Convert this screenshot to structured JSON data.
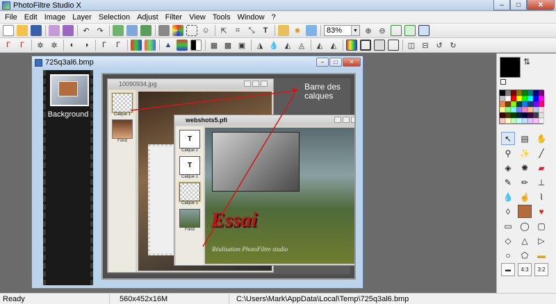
{
  "app": {
    "title": "PhotoFiltre Studio X"
  },
  "window_controls": {
    "minimize": "–",
    "maximize": "□",
    "close": "✕"
  },
  "menu": [
    "File",
    "Edit",
    "Image",
    "Layer",
    "Selection",
    "Adjust",
    "Filter",
    "View",
    "Tools",
    "Window",
    "?"
  ],
  "toolbar": {
    "zoom_value": "83%"
  },
  "document": {
    "title": "725q3al6.bmp",
    "film_label": "Background",
    "inner_window_1": {
      "title": "10090934.jpg",
      "layers": [
        "Calque 1",
        "Fond"
      ]
    },
    "inner_window_2": {
      "title": "webshots5.pfi",
      "layers": [
        "Calque 2",
        "Calque 1",
        "Calque 1",
        "Fond"
      ]
    },
    "annotation": "Barre des calques",
    "overlay_title": "Essai",
    "overlay_credit": "Réalisation PhotoFiltre studio"
  },
  "panel": {
    "foreground_color": "#000000",
    "background_color": "#ffffff"
  },
  "status": {
    "state": "Ready",
    "size": "560x452x16M",
    "path": "C:\\Users\\Mark\\AppData\\Local\\Temp\\725q3al6.bmp"
  }
}
